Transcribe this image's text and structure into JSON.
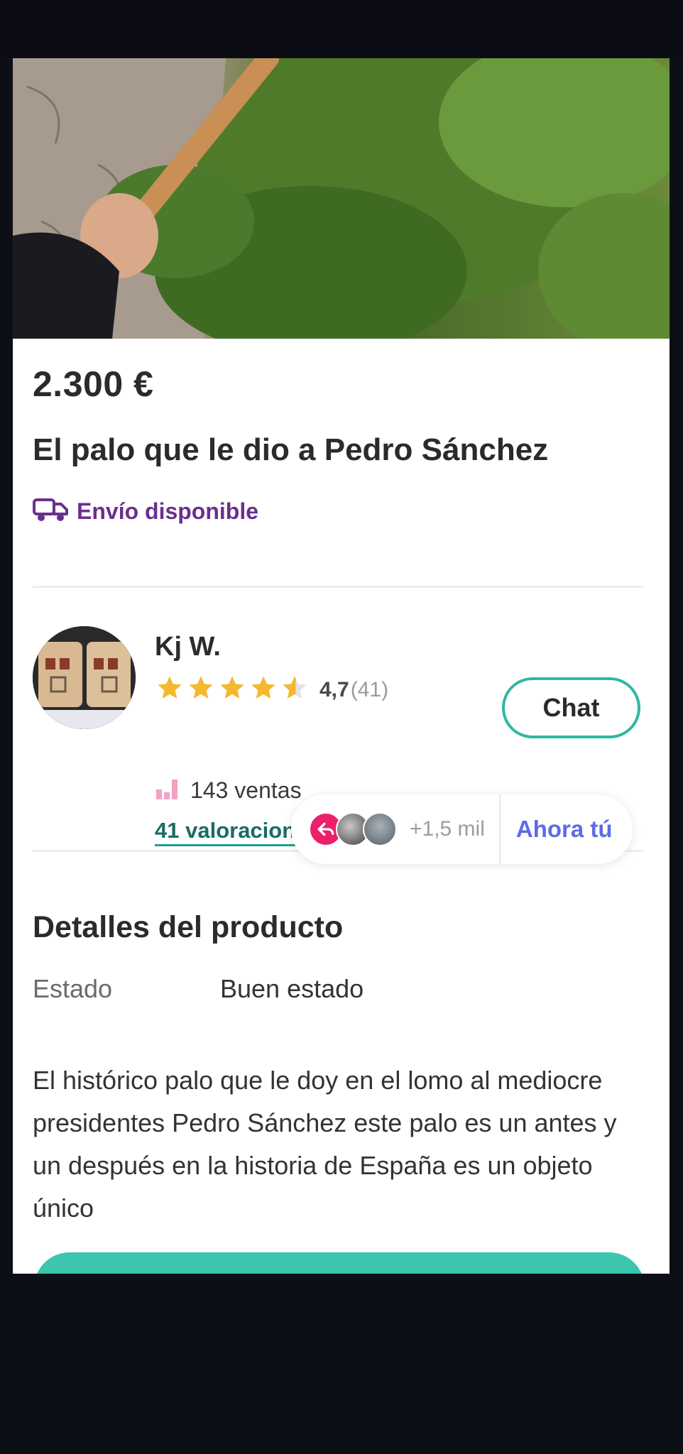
{
  "product": {
    "price": "2.300 €",
    "title": "El palo que le dio a Pedro Sánchez",
    "shipping": "Envío disponible"
  },
  "seller": {
    "name": "Kj W.",
    "rating": "4,7",
    "rating_count": "(41)",
    "rating_value": 4.7,
    "sales": "143 ventas",
    "reviews_link": "41 valoraciones",
    "chat_label": "Chat"
  },
  "social_pill": {
    "count": "+1,5 mil",
    "cta": "Ahora tú"
  },
  "details": {
    "heading": "Detalles del producto",
    "state_label": "Estado",
    "state_value": "Buen estado",
    "description": "El histórico palo que le doy en el lomo al mediocre presidentes Pedro Sánchez este palo es un antes y un después en la historia de España es un objeto único"
  },
  "colors": {
    "accent": "#2fb8a1",
    "shipping": "#6a2f8f",
    "star": "#f5b82e",
    "cta": "#5d6be6",
    "reshare": "#ec1f6b"
  },
  "icons": {
    "shipping": "truck-icon",
    "sales": "bar-chart-icon",
    "reshare": "reply-icon",
    "stars": "star-icon"
  }
}
